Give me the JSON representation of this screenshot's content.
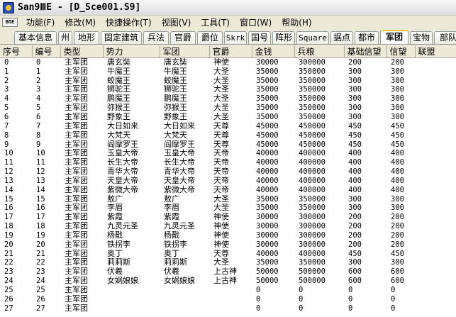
{
  "window": {
    "title": "San9ⅢE - [D_Sce001.S9]"
  },
  "menu": {
    "logo": "BOE",
    "items": [
      "功能(F)",
      "修改(M)",
      "快捷操作(T)",
      "视图(V)",
      "工具(T)",
      "窗口(W)",
      "帮助(H)"
    ]
  },
  "tabs": [
    "基本信息",
    "州",
    "地形",
    "固定建筑",
    "兵法",
    "官爵",
    "爵位",
    "Skrk",
    "国号",
    "阵形",
    "Square",
    "据点",
    "都市",
    "军团",
    "宝物",
    "部队"
  ],
  "active_tab": "军团",
  "table": {
    "columns": [
      "序号",
      "编号",
      "类型",
      "势力",
      "军团",
      "官爵",
      "金钱",
      "兵粮",
      "基础信望",
      "信望",
      "联盟"
    ],
    "rows": [
      [
        "0",
        "0",
        "主军团",
        "唐玄奘",
        "唐玄奘",
        "神使",
        "30000",
        "300000",
        "200",
        "200",
        ""
      ],
      [
        "1",
        "1",
        "主军团",
        "牛魔王",
        "牛魔王",
        "大圣",
        "35000",
        "350000",
        "300",
        "300",
        ""
      ],
      [
        "2",
        "2",
        "主军团",
        "蛟魔王",
        "蛟魔王",
        "大圣",
        "35000",
        "350000",
        "300",
        "300",
        ""
      ],
      [
        "3",
        "3",
        "主军团",
        "狮驼王",
        "狮驼王",
        "大圣",
        "35000",
        "350000",
        "300",
        "300",
        ""
      ],
      [
        "4",
        "4",
        "主军团",
        "鹏魔王",
        "鹏魔王",
        "大圣",
        "35000",
        "350000",
        "300",
        "300",
        ""
      ],
      [
        "5",
        "5",
        "主军团",
        "弥猴王",
        "弥猴王",
        "大圣",
        "35000",
        "350000",
        "300",
        "300",
        ""
      ],
      [
        "6",
        "6",
        "主军团",
        "野象王",
        "野象王",
        "大圣",
        "35000",
        "350000",
        "300",
        "300",
        ""
      ],
      [
        "7",
        "7",
        "主军团",
        "大日如来",
        "大日如来",
        "天尊",
        "45000",
        "450000",
        "450",
        "450",
        ""
      ],
      [
        "8",
        "8",
        "主军团",
        "大梵天",
        "大梵天",
        "天尊",
        "45000",
        "450000",
        "450",
        "450",
        ""
      ],
      [
        "9",
        "9",
        "主军团",
        "阎摩罗王",
        "阎摩罗王",
        "天尊",
        "45000",
        "450000",
        "450",
        "450",
        ""
      ],
      [
        "10",
        "10",
        "主军团",
        "玉皇大帝",
        "玉皇大帝",
        "天帝",
        "40000",
        "400000",
        "400",
        "400",
        ""
      ],
      [
        "11",
        "11",
        "主军团",
        "长生大帝",
        "长生大帝",
        "天帝",
        "40000",
        "400000",
        "400",
        "400",
        ""
      ],
      [
        "12",
        "12",
        "主军团",
        "青华大帝",
        "青华大帝",
        "天帝",
        "40000",
        "400000",
        "400",
        "400",
        ""
      ],
      [
        "13",
        "13",
        "主军团",
        "天皇大帝",
        "天皇大帝",
        "天帝",
        "40000",
        "400000",
        "400",
        "400",
        ""
      ],
      [
        "14",
        "14",
        "主军团",
        "紫微大帝",
        "紫微大帝",
        "天帝",
        "40000",
        "400000",
        "400",
        "400",
        ""
      ],
      [
        "15",
        "15",
        "主军团",
        "敖广",
        "敖广",
        "大圣",
        "35000",
        "350000",
        "300",
        "300",
        ""
      ],
      [
        "16",
        "16",
        "主军团",
        "李眉",
        "李眉",
        "大圣",
        "35000",
        "350000",
        "300",
        "300",
        ""
      ],
      [
        "17",
        "17",
        "主军团",
        "紫霞",
        "紫霞",
        "神使",
        "30000",
        "300000",
        "200",
        "200",
        ""
      ],
      [
        "18",
        "18",
        "主军团",
        "九灵元圣",
        "九灵元圣",
        "神使",
        "30000",
        "300000",
        "200",
        "200",
        ""
      ],
      [
        "19",
        "19",
        "主军团",
        "杨戬",
        "杨戬",
        "神使",
        "30000",
        "300000",
        "200",
        "200",
        ""
      ],
      [
        "20",
        "20",
        "主军团",
        "铁拐李",
        "铁拐李",
        "神使",
        "30000",
        "300000",
        "200",
        "200",
        ""
      ],
      [
        "21",
        "21",
        "主军团",
        "奥丁",
        "奥丁",
        "天尊",
        "40000",
        "400000",
        "450",
        "450",
        ""
      ],
      [
        "22",
        "22",
        "主军团",
        "莉莉斯",
        "莉莉斯",
        "大圣",
        "35000",
        "350000",
        "300",
        "300",
        ""
      ],
      [
        "23",
        "23",
        "主军团",
        "伏羲",
        "伏羲",
        "上古神",
        "50000",
        "500000",
        "600",
        "600",
        ""
      ],
      [
        "24",
        "24",
        "主军团",
        "女娲娘娘",
        "女娲娘娘",
        "上古神",
        "50000",
        "500000",
        "600",
        "600",
        ""
      ],
      [
        "25",
        "25",
        "主军团",
        "",
        "",
        "",
        "0",
        "0",
        "0",
        "0",
        ""
      ],
      [
        "26",
        "26",
        "主军团",
        "",
        "",
        "",
        "0",
        "0",
        "0",
        "0",
        ""
      ],
      [
        "27",
        "27",
        "主军团",
        "",
        "",
        "",
        "0",
        "0",
        "0",
        "0",
        ""
      ]
    ]
  }
}
